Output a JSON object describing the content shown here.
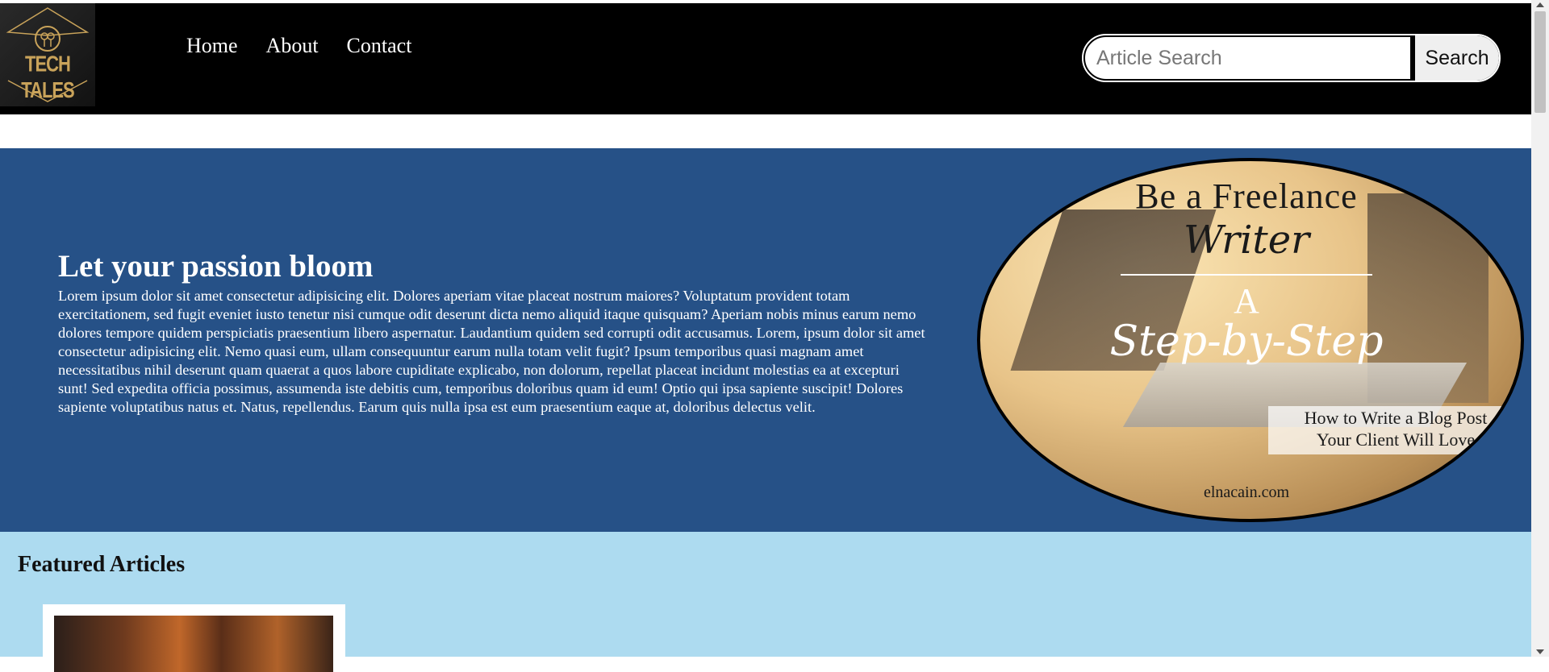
{
  "logo": {
    "text": "TECH TALES",
    "icon": "gear-keys-icon"
  },
  "nav": {
    "links": [
      {
        "label": "Home"
      },
      {
        "label": "About"
      },
      {
        "label": "Contact"
      }
    ]
  },
  "search": {
    "placeholder": "Article Search",
    "value": "",
    "button_label": "Search"
  },
  "hero": {
    "title": "Let your passion bloom",
    "text": "Lorem ipsum dolor sit amet consectetur adipisicing elit. Dolores aperiam vitae placeat nostrum maiores? Voluptatum provident totam exercitationem, sed fugit eveniet iusto tenetur nisi cumque odit deserunt dicta nemo aliquid itaque quisquam? Aperiam nobis minus earum nemo dolores tempore quidem perspiciatis praesentium libero aspernatur. Laudantium quidem sed corrupti odit accusamus. Lorem, ipsum dolor sit amet consectetur adipisicing elit. Nemo quasi eum, ullam consequuntur earum nulla totam velit fugit? Ipsum temporibus quasi magnam amet necessitatibus nihil deserunt quam quaerat a quos labore cupiditate explicabo, non dolorum, repellat placeat incidunt molestias ea at excepturi sunt! Sed expedita officia possimus, assumenda iste debitis cum, temporibus doloribus quam id eum! Optio qui ipsa sapiente suscipit! Dolores sapiente voluptatibus natus et. Natus, repellendus. Earum quis nulla ipsa est eum praesentium eaque at, doloribus delectus velit.",
    "image": {
      "line1": "Be a Freelance",
      "line2": "Writer",
      "line3": "A",
      "line4": "Step-by-Step",
      "line5": "How to Write a Blog Post",
      "line6": "Your Client Will Love",
      "site": "elnacain.com"
    }
  },
  "featured": {
    "title": "Featured Articles"
  },
  "colors": {
    "navbar": "#000000",
    "hero_bg": "#265187",
    "featured_bg": "#addbf0",
    "logo_gold": "#c9a35a"
  }
}
